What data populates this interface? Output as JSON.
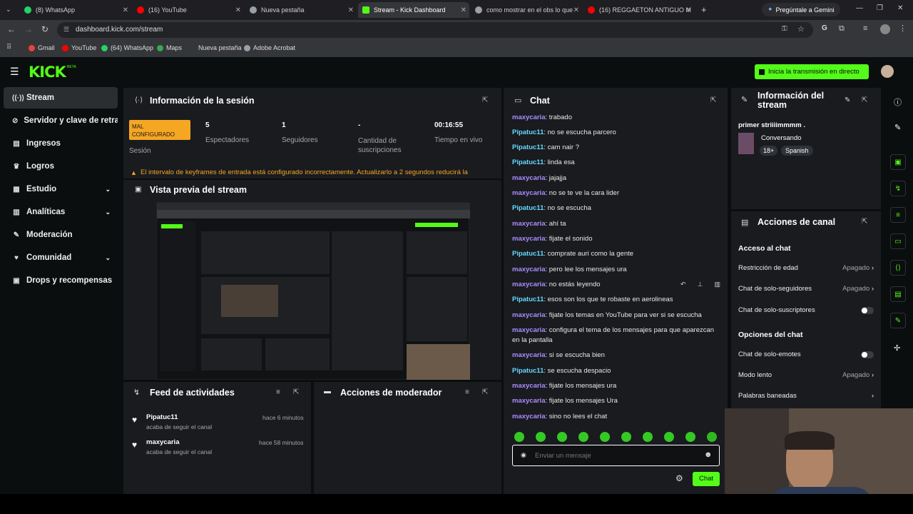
{
  "browser": {
    "tabs": [
      {
        "title": "(8) WhatsApp",
        "color": "#25d366"
      },
      {
        "title": "(16) YouTube",
        "color": "#ff0000"
      },
      {
        "title": "Nueva pestaña",
        "color": "#9aa0a6"
      },
      {
        "title": "Stream - Kick Dashboard",
        "color": "#53fc18"
      },
      {
        "title": "como mostrar en el obs lo que",
        "color": "#9aa0a6"
      },
      {
        "title": "(16) REGGAETON ANTIGUO M",
        "color": "#ff0000"
      }
    ],
    "gemini": "Pregúntale a Gemini",
    "url": "dashboard.kick.com/stream",
    "bookmarks": [
      "Gmail",
      "YouTube",
      "(64) WhatsApp",
      "Maps",
      "Nueva pestaña",
      "Adobe Acrobat"
    ]
  },
  "app": {
    "logo": "KICK",
    "logo_sup": "BETA",
    "go_live": "Inicia la transmisión en directo",
    "accent": "#53fc18"
  },
  "sidebar": {
    "items": [
      {
        "label": "Stream",
        "icon": "broadcast-icon"
      },
      {
        "label": "Servidor y clave de retransmisión",
        "icon": "link-icon"
      },
      {
        "label": "Ingresos",
        "icon": "money-icon"
      },
      {
        "label": "Logros",
        "icon": "trophy-icon"
      },
      {
        "label": "Estudio",
        "icon": "studio-icon"
      },
      {
        "label": "Analíticas",
        "icon": "chart-icon"
      },
      {
        "label": "Moderación",
        "icon": "wrench-icon"
      },
      {
        "label": "Comunidad",
        "icon": "heart-icon"
      },
      {
        "label": "Drops y recompensas",
        "icon": "gift-icon"
      }
    ]
  },
  "session": {
    "title": "Información de la sesión",
    "badge": "MAL CONFIGURADO",
    "badge_label": "Sesión",
    "stats": [
      {
        "value": "5",
        "label": "Espectadores"
      },
      {
        "value": "1",
        "label": "Seguidores"
      },
      {
        "value": "-",
        "label": "Cantidad de suscripciones"
      },
      {
        "value": "00:16:55",
        "label": "Tiempo en vivo"
      }
    ],
    "warning": "El intervalo de keyframes de entrada está configurado incorrectamente. Actualizarlo a 2 segundos reducirá la"
  },
  "preview": {
    "title": "Vista previa del stream"
  },
  "feed": {
    "title": "Feed de actividades",
    "items": [
      {
        "user": "Pipatuc11",
        "action": "acaba de seguir el canal",
        "time": "hace 6 minutos"
      },
      {
        "user": "maxycaria",
        "action": "acaba de seguir el canal",
        "time": "hace 58 minutos"
      }
    ]
  },
  "modactions": {
    "title": "Acciones de moderador"
  },
  "chat": {
    "title": "Chat",
    "messages": [
      {
        "user": "maxycaria",
        "text": "trabado"
      },
      {
        "user": "Pipatuc11",
        "text": "no se escucha parcero"
      },
      {
        "user": "Pipatuc11",
        "text": "cam nair ?"
      },
      {
        "user": "Pipatuc11",
        "text": "linda esa"
      },
      {
        "user": "maxycaria",
        "text": "jajajja"
      },
      {
        "user": "maxycaria",
        "text": "no se te ve la cara lider"
      },
      {
        "user": "Pipatuc11",
        "text": "no se escucha"
      },
      {
        "user": "maxycaria",
        "text": "ahí ta"
      },
      {
        "user": "maxycaria",
        "text": "fijate el sonido"
      },
      {
        "user": "Pipatuc11",
        "text": "comprate auri como la gente"
      },
      {
        "user": "maxycaria",
        "text": "pero lee los mensajes ura"
      },
      {
        "user": "maxycaria",
        "text": "no estás leyendo"
      },
      {
        "user": "Pipatuc11",
        "text": "esos son los que te robaste en aerolineas"
      },
      {
        "user": "maxycaria",
        "text": "fijate los temas en YouTube para ver si se escucha"
      },
      {
        "user": "maxycaria",
        "text": "configura el tema de los mensajes para que aparezcan en la pantalla"
      },
      {
        "user": "maxycaria",
        "text": "si se escucha bien"
      },
      {
        "user": "Pipatuc11",
        "text": "se escucha despacio"
      },
      {
        "user": "maxycaria",
        "text": "fijate los mensajes ura"
      },
      {
        "user": "maxycaria",
        "text": "fijate los mensajes Ura"
      },
      {
        "user": "maxycaria",
        "text": "sino no lees el chat"
      }
    ],
    "placeholder": "Enviar un mensaje",
    "send": "Chat"
  },
  "streaminfo": {
    "title": "Información del stream",
    "stream_title": "primer striiiimmmm .",
    "category": "Conversando",
    "tags": [
      "18+",
      "Spanish"
    ]
  },
  "channel": {
    "title": "Acciones de canal",
    "section1": "Acceso al chat",
    "rows1": [
      {
        "label": "Restricción de edad",
        "value": "Apagado"
      },
      {
        "label": "Chat de solo-seguidores",
        "value": "Apagado"
      },
      {
        "label": "Chat de solo-suscriptores",
        "value": ""
      }
    ],
    "section2": "Opciones del chat",
    "rows2": [
      {
        "label": "Chat de solo-emotes",
        "value": ""
      },
      {
        "label": "Modo lento",
        "value": "Apagado"
      },
      {
        "label": "Palabras baneadas",
        "value": ""
      }
    ]
  }
}
